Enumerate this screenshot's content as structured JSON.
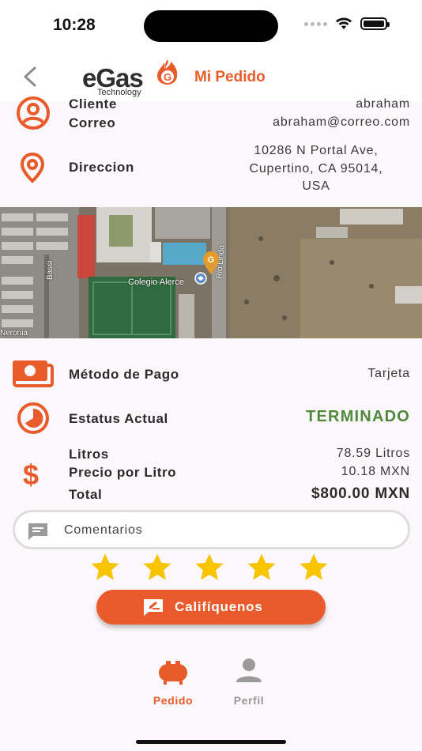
{
  "status_bar": {
    "time": "10:28"
  },
  "header": {
    "logo_text": "eGas",
    "logo_subtext": "Technology",
    "logo_badge": "G",
    "title": "Mi Pedido"
  },
  "customer": {
    "cliente_label": "Cliente",
    "cliente_value": "abraham",
    "correo_label": "Correo",
    "correo_value": "abraham@correo.com",
    "direccion_label": "Direccion",
    "direccion_lines": [
      "10286 N Portal Ave,",
      "Cupertino, CA 95014,",
      "USA"
    ]
  },
  "map": {
    "labels": {
      "school": "Colegio Alerce",
      "street_1": "Rio Lindo",
      "street_2": "Bassi",
      "street_3": "Neronia"
    },
    "marker_badge": "G"
  },
  "payment": {
    "label": "Método de Pago",
    "value": "Tarjeta"
  },
  "status": {
    "label": "Estatus Actual",
    "value": "TERMINADO"
  },
  "totals": {
    "litros_label": "Litros",
    "litros_value": "78.59 Litros",
    "precio_label": "Precio por Litro",
    "precio_value": "10.18 MXN",
    "total_label": "Total",
    "total_value": "$800.00 MXN"
  },
  "comments": {
    "placeholder": "Comentarios"
  },
  "rating": {
    "stars": 5
  },
  "rate_button": {
    "label": "Califíquenos"
  },
  "tabs": [
    {
      "label": "Pedido",
      "active": true
    },
    {
      "label": "Perfil",
      "active": false
    }
  ],
  "colors": {
    "accent": "#e85b2a",
    "status_green": "#4f8a3c",
    "star": "#f7c400",
    "inactive": "#9a9a9a"
  }
}
